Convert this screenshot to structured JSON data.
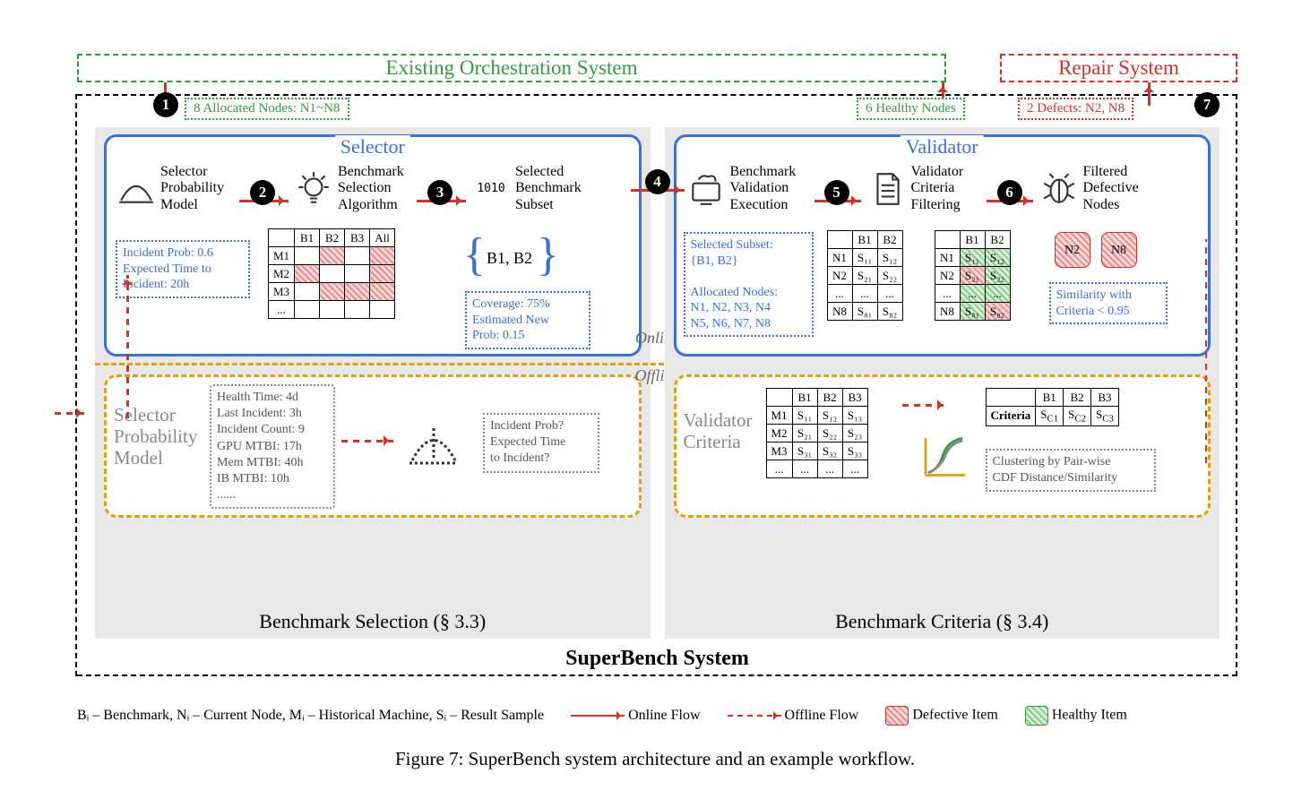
{
  "top": {
    "orchestration": "Existing Orchestration System",
    "repair": "Repair System"
  },
  "system_name": "SuperBench System",
  "badges": {
    "allocated": "8 Allocated Nodes: N1~N8",
    "healthy": "6 Healthy Nodes",
    "defects": "2 Defects: N2, N8"
  },
  "steps": [
    "1",
    "2",
    "3",
    "4",
    "5",
    "6",
    "7"
  ],
  "selector": {
    "title": "Selector",
    "stage1": "Selector\nProbability\nModel",
    "stage2": "Benchmark\nSelection\nAlgorithm",
    "stage3": "Selected\nBenchmark\nSubset",
    "subset": "B1, B2",
    "info_prob": "Incident Prob: 0.6\nExpected Time to\nIncident: 20h",
    "info_cov": "Coverage: 75%\nEstimated New\nProb: 0.15",
    "matrix_cols": [
      "B1",
      "B2",
      "B3",
      "All"
    ],
    "matrix_rows": [
      "M1",
      "M2",
      "M3",
      "..."
    ],
    "panel_title": "Benchmark Selection (§ 3.3)"
  },
  "validator": {
    "title": "Validator",
    "stage1": "Benchmark\nValidation\nExecution",
    "stage2": "Validator\nCriteria\nFiltering",
    "stage3": "Filtered\nDefective\nNodes",
    "info_sel": "Selected Subset:\n{B1, B2}\n\nAllocated Nodes:\nN1, N2, N3, N4\nN5, N6, N7, N8",
    "info_sim": "Similarity with\nCriteria < 0.95",
    "score_cols": [
      "B1",
      "B2"
    ],
    "score_rows": [
      "N1",
      "N2",
      "...",
      "N8"
    ],
    "score_rows_all": [
      "N1",
      "N2",
      "...",
      "N8"
    ],
    "defect_nodes": [
      "N2",
      "N8"
    ],
    "panel_title": "Benchmark Criteria (§ 3.4)"
  },
  "offline_left": {
    "label": "Selector\nProbability\nModel",
    "scroll": "Health Time: 4d\nLast Incident: 3h\nIncident Count: 9\nGPU MTBI: 17h\nMem MTBI: 40h\nIB MTBI: 10h\n......",
    "query": "Incident Prob?\nExpected Time\nto Incident?"
  },
  "offline_right": {
    "label": "Validator\nCriteria",
    "data_cols": [
      "B1",
      "B2",
      "B3"
    ],
    "data_rows": [
      "M1",
      "M2",
      "M3",
      "..."
    ],
    "crit_cols": [
      "B1",
      "B2",
      "B3"
    ],
    "crit_row_label": "Criteria",
    "cluster": "Clustering by Pair-wise\nCDF Distance/Similarity"
  },
  "oo": {
    "online": "Online",
    "offline": "Offline"
  },
  "legend": {
    "symbols": "Bᵢ – Benchmark, Nᵢ – Current Node, Mᵢ – Historical Machine, Sᵢ – Result Sample",
    "online_flow": "Online Flow",
    "offline_flow": "Offline Flow",
    "defective": "Defective Item",
    "healthy": "Healthy Item"
  },
  "caption": "Figure 7: SuperBench system architecture and an example workflow."
}
